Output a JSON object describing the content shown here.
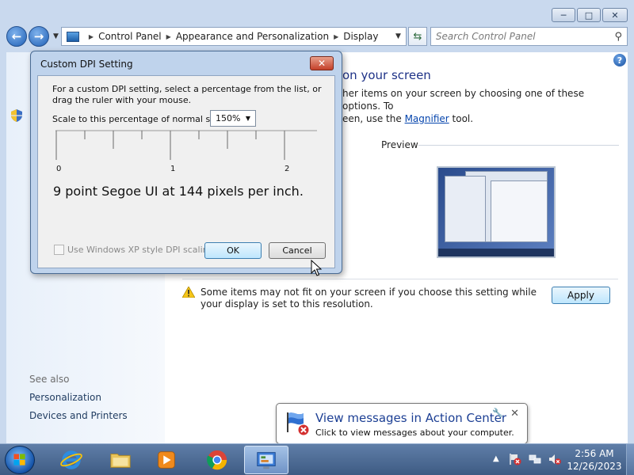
{
  "window": {
    "buttons": {
      "minimize": "─",
      "maximize": "□",
      "close": "✕"
    }
  },
  "navbar": {
    "back": "←",
    "forward": "→",
    "breadcrumb": [
      "Control Panel",
      "Appearance and Personalization",
      "Display"
    ],
    "search_placeholder": "Search Control Panel"
  },
  "leftpane": {
    "see_also": "See also",
    "links": [
      "Personalization",
      "Devices and Printers"
    ]
  },
  "main": {
    "heading_fragment": "on your screen",
    "desc_line1": "her items on your screen by choosing one of these options. To",
    "desc_line2_prefix": "een, use the ",
    "desc_link": "Magnifier",
    "desc_line2_suffix": " tool.",
    "preview_label": "Preview",
    "warning_text": "Some items may not fit on your screen if you choose this setting while your display is set to this resolution.",
    "apply_label": "Apply",
    "help": "?"
  },
  "dialog": {
    "title": "Custom DPI Setting",
    "close": "✕",
    "description": "For a custom DPI setting, select a percentage from the list, or drag the ruler with your mouse.",
    "scale_label": "Scale to this percentage of normal size:",
    "scale_value": "150%",
    "ruler_labels": [
      "0",
      "1",
      "2"
    ],
    "sample_text": "9 point Segoe UI at 144 pixels per inch.",
    "xp_checkbox_label": "Use Windows XP style DPI scaling",
    "xp_checked": false,
    "ok_label": "OK",
    "cancel_label": "Cancel"
  },
  "balloon": {
    "title": "View messages in Action Center",
    "text": "Click to view messages about your computer.",
    "close": "✕",
    "pin": "🔧"
  },
  "taskbar": {
    "apps": [
      "internet-explorer",
      "windows-explorer",
      "media-player",
      "chrome",
      "control-panel"
    ],
    "active_app": "control-panel",
    "tray_chevron": "▲",
    "clock_time": "2:56 AM",
    "clock_date": "12/26/2023"
  },
  "colors": {
    "link": "#0645ad",
    "heading": "#1e3287",
    "balloon_title": "#1c3f94"
  }
}
